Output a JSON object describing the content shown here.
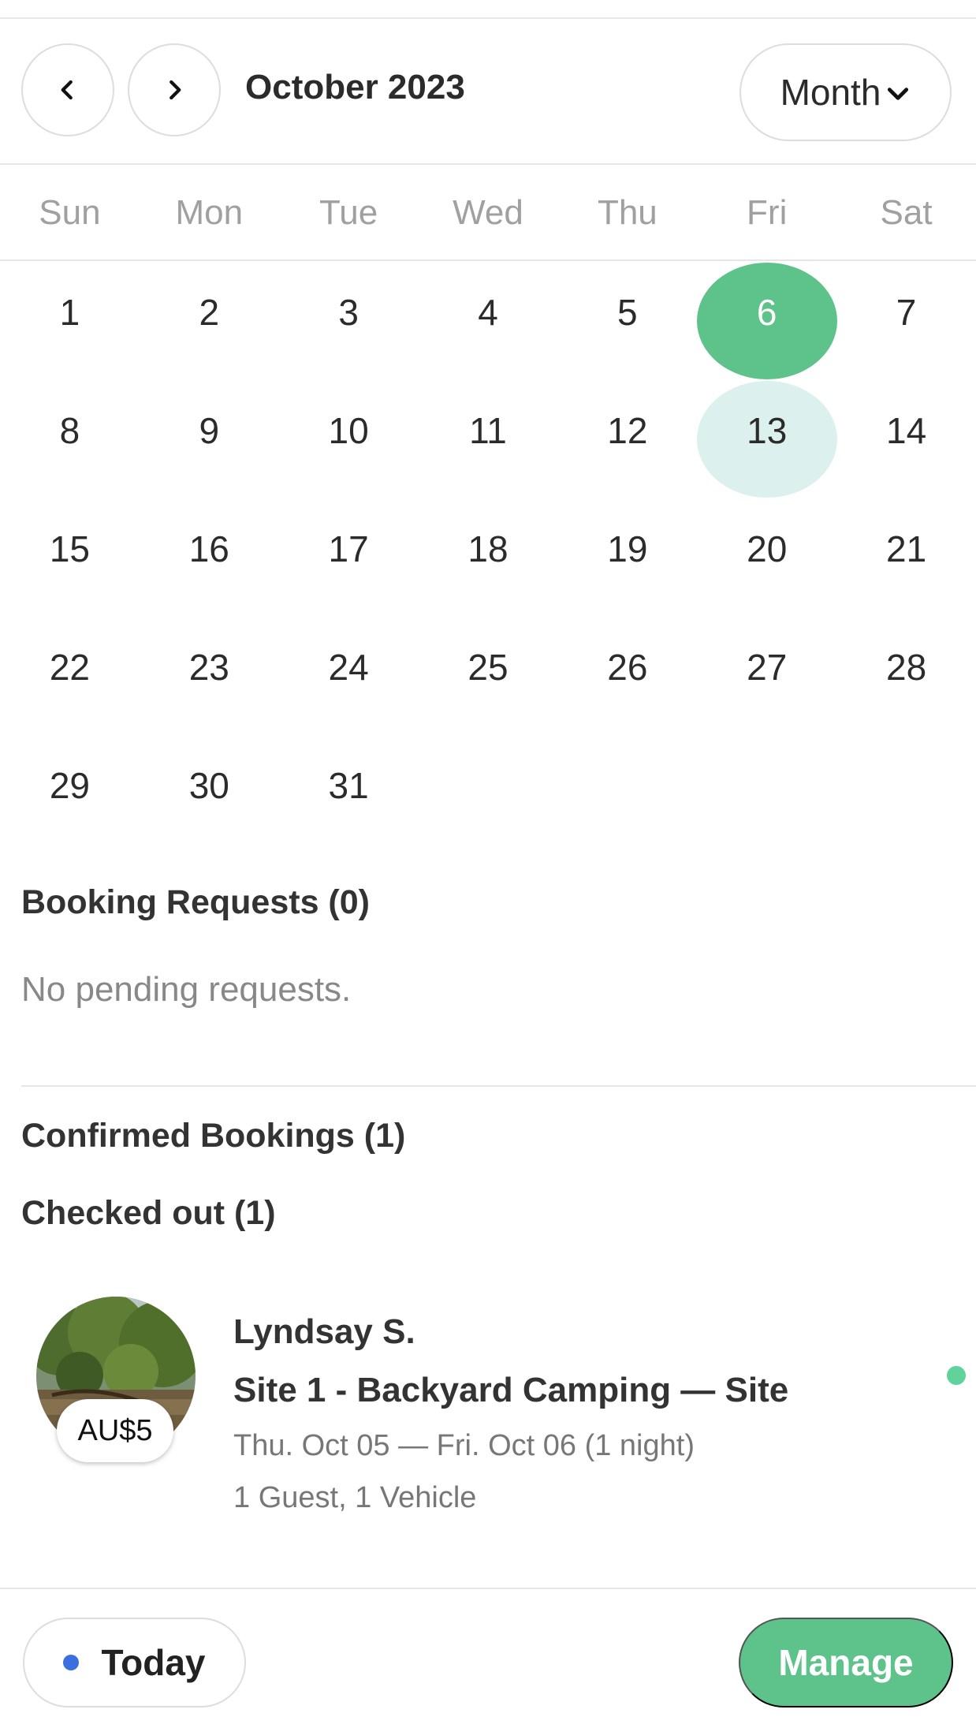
{
  "header": {
    "prev_icon": "chevron-left-icon",
    "next_icon": "chevron-right-icon",
    "month_title": "October 2023",
    "view_select": {
      "label": "Month",
      "icon": "chevron-down-icon"
    }
  },
  "calendar": {
    "weekdays": [
      "Sun",
      "Mon",
      "Tue",
      "Wed",
      "Thu",
      "Fri",
      "Sat"
    ],
    "days": [
      "1",
      "2",
      "3",
      "4",
      "5",
      "6",
      "7",
      "8",
      "9",
      "10",
      "11",
      "12",
      "13",
      "14",
      "15",
      "16",
      "17",
      "18",
      "19",
      "20",
      "21",
      "22",
      "23",
      "24",
      "25",
      "26",
      "27",
      "28",
      "29",
      "30",
      "31"
    ],
    "selected_day": "6",
    "highlighted_day": "13",
    "colors": {
      "selected": "#5ec38a",
      "highlight": "#dcf1ee"
    }
  },
  "booking_requests": {
    "title": "Booking Requests (0)",
    "empty_text": "No pending requests."
  },
  "confirmed": {
    "title": "Confirmed Bookings (1)",
    "checked_out_title": "Checked out (1)",
    "items": [
      {
        "price": "AU$5",
        "guest": "Lyndsay S.",
        "site": "Site 1 - Backyard Camping — Site",
        "dates": "Thu. Oct 05 — Fri. Oct 06 (1 night)",
        "party": "1 Guest, 1 Vehicle",
        "status_color": "#5fd39b"
      }
    ]
  },
  "footer": {
    "today_label": "Today",
    "today_dot_color": "#3b6fde",
    "manage_label": "Manage",
    "accent": "#5ec38a"
  }
}
